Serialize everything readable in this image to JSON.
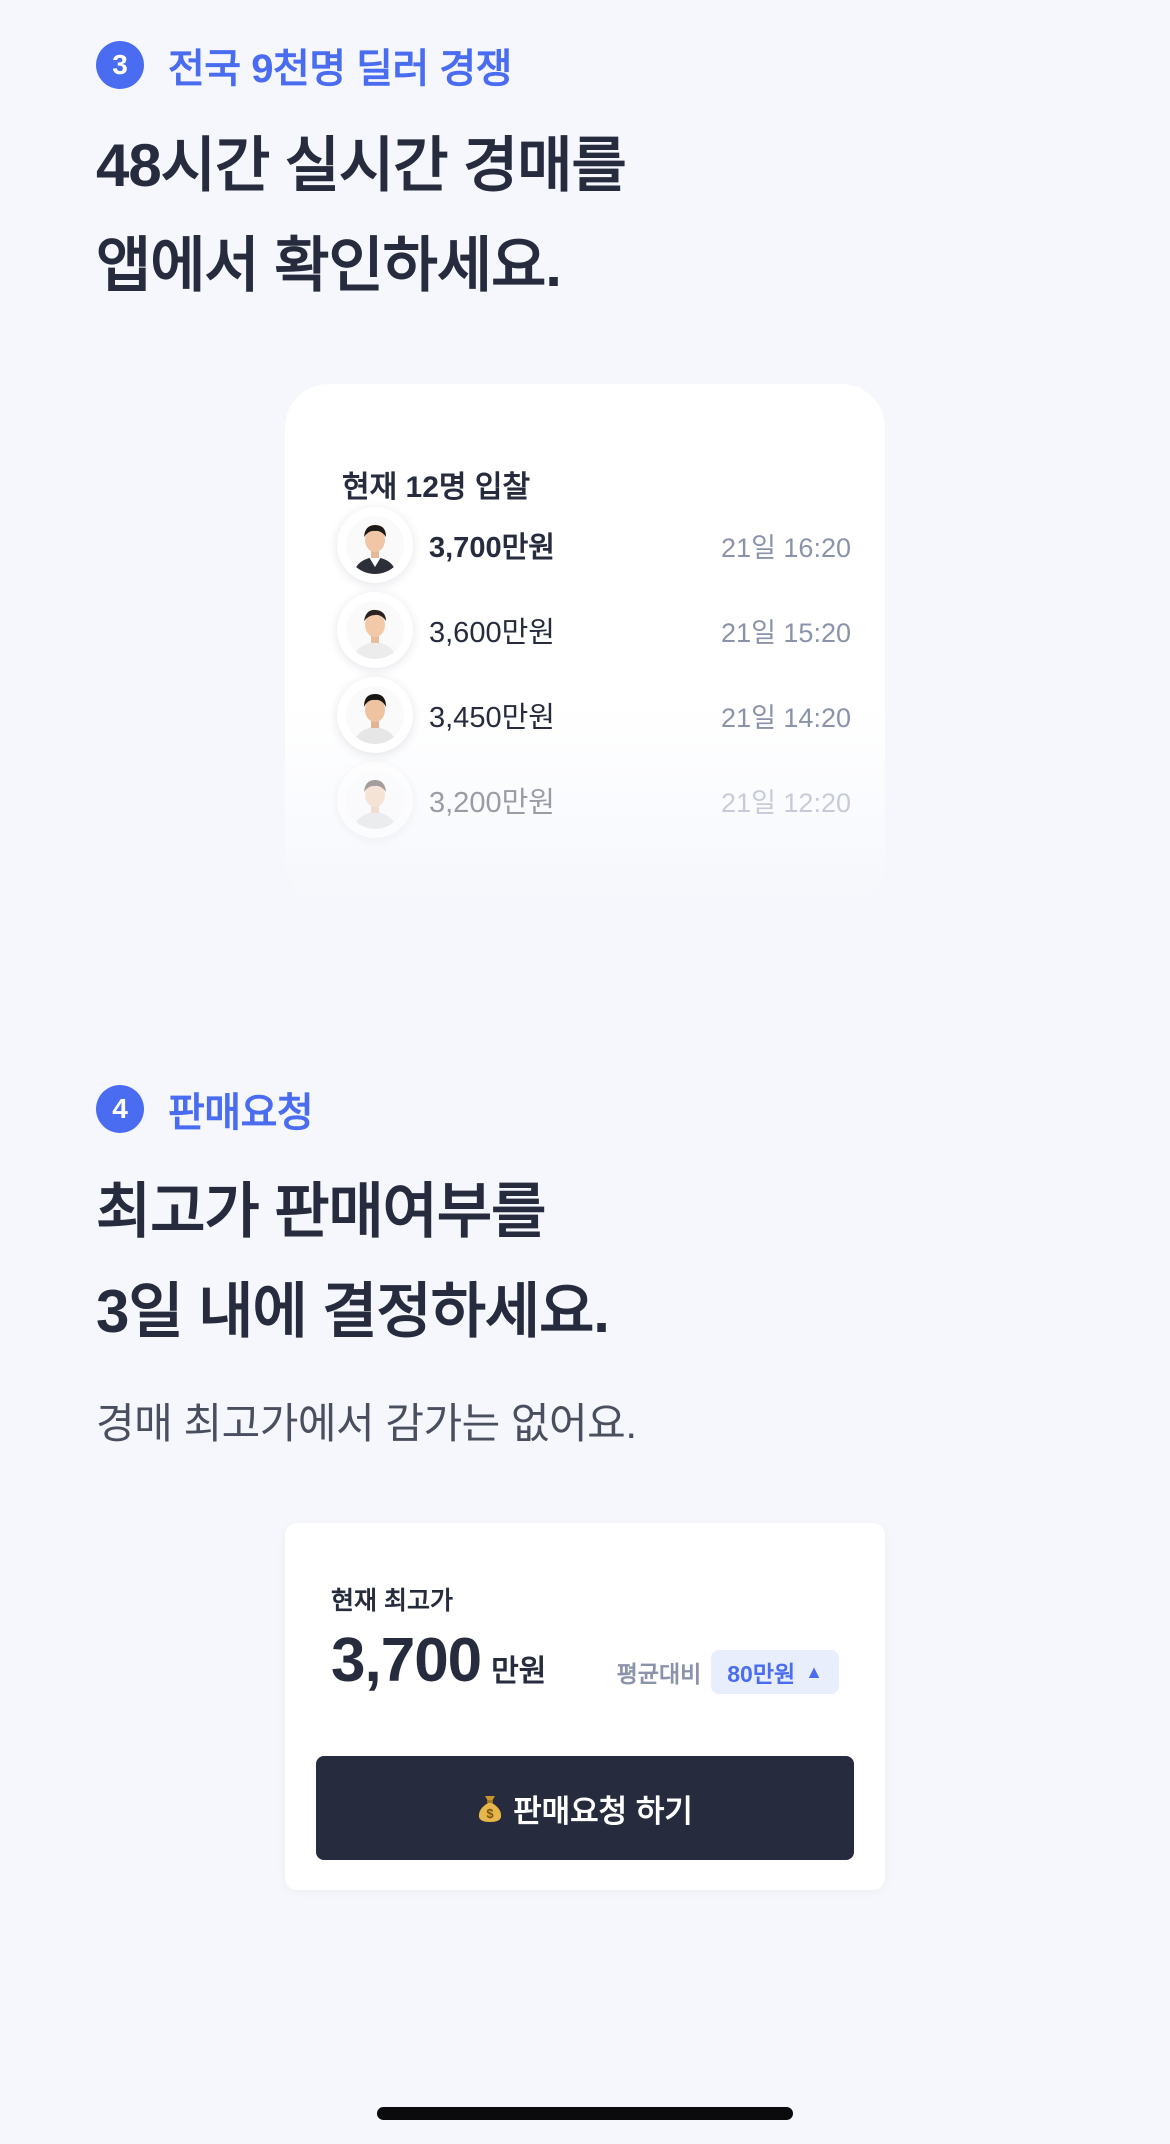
{
  "section3": {
    "badge": "3",
    "label": "전국 9천명 딜러 경쟁",
    "headline_line1": "48시간 실시간 경매를",
    "headline_line2": "앱에서 확인하세요."
  },
  "bids": {
    "title": "현재 12명 입찰",
    "rows": [
      {
        "amount": "3,700만원",
        "time": "21일 16:20"
      },
      {
        "amount": "3,600만원",
        "time": "21일 15:20"
      },
      {
        "amount": "3,450만원",
        "time": "21일 14:20"
      },
      {
        "amount": "3,200만원",
        "time": "21일 12:20"
      }
    ]
  },
  "section4": {
    "badge": "4",
    "label": "판매요청",
    "headline_line1": "최고가 판매여부를",
    "headline_line2": "3일 내에 결정하세요.",
    "description": "경매 최고가에서 감가는 없어요."
  },
  "price_card": {
    "label": "현재 최고가",
    "value": "3,700",
    "unit": "만원",
    "avg_label": "평균대비",
    "avg_value": "80만원",
    "avg_icon": "triangle-up-icon",
    "button_label": "판매요청 하기",
    "button_icon": "money-bag-icon"
  },
  "colors": {
    "accent": "#4a6cf0",
    "dark": "#262b3d",
    "muted": "#8b93ab",
    "background": "#f5f7fc"
  }
}
